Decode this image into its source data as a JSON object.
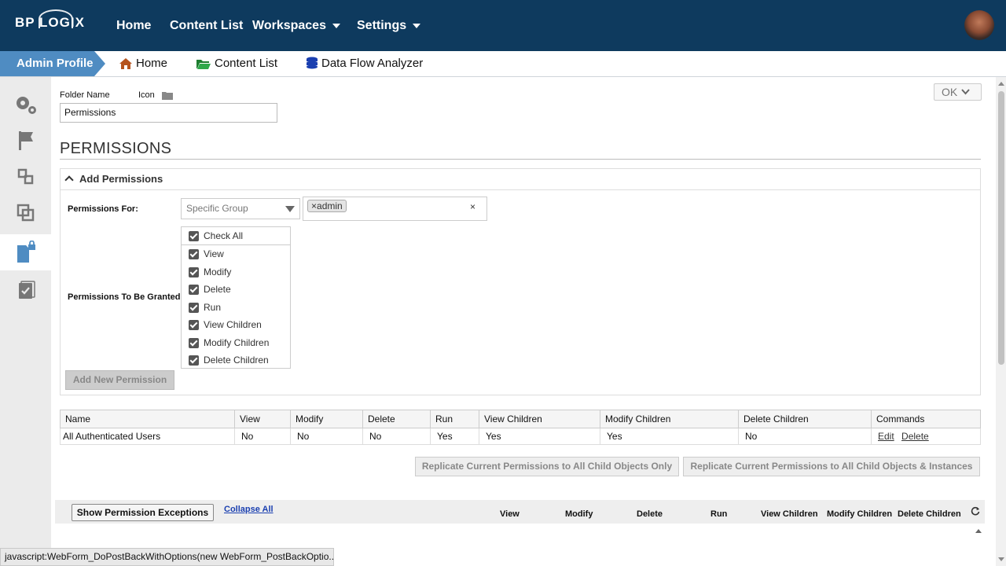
{
  "brand": {
    "logo_text": "BP LOGIX"
  },
  "topnav": {
    "home": "Home",
    "content_list": "Content List",
    "workspaces": "Workspaces",
    "settings": "Settings"
  },
  "subnav": {
    "profile": "Admin Profile",
    "home": "Home",
    "content_list": "Content List",
    "data_flow": "Data Flow Analyzer"
  },
  "sidebar": {
    "items": [
      "gears-icon",
      "flag-icon",
      "nodes-icon",
      "copy-icon",
      "lock-file-icon",
      "checklist-icon"
    ]
  },
  "form": {
    "folder_name_label": "Folder Name",
    "icon_label": "Icon",
    "folder_name_value": "Permissions",
    "ok_label": "OK"
  },
  "section": {
    "title": "PERMISSIONS"
  },
  "add_panel": {
    "title": "Add Permissions",
    "permissions_for_label": "Permissions For:",
    "permissions_for_value": "Specific Group",
    "selected_tag": "admin",
    "tag_remove": "×",
    "tag_clear": "×",
    "granted_label": "Permissions To Be Granted",
    "check_all": "Check All",
    "checks": [
      "View",
      "Modify",
      "Delete",
      "Run",
      "View Children",
      "Modify Children",
      "Delete Children"
    ],
    "add_button": "Add New Permission"
  },
  "table": {
    "headers": [
      "Name",
      "View",
      "Modify",
      "Delete",
      "Run",
      "View Children",
      "Modify Children",
      "Delete Children",
      "Commands"
    ],
    "rows": [
      {
        "name": "All Authenticated Users",
        "view": "No",
        "modify": "No",
        "delete": "No",
        "run": "Yes",
        "view_children": "Yes",
        "modify_children": "Yes",
        "delete_children": "No",
        "edit": "Edit",
        "delete_link": "Delete"
      }
    ]
  },
  "replicate": {
    "child_objects_only": "Replicate Current Permissions to All Child Objects Only",
    "child_objects_instances": "Replicate Current Permissions to All Child Objects & Instances"
  },
  "exceptions": {
    "show_button": "Show Permission Exceptions",
    "collapse_all": "Collapse All",
    "columns": [
      "View",
      "Modify",
      "Delete",
      "Run",
      "View Children",
      "Modify Children",
      "Delete Children"
    ]
  },
  "status_bar": "javascript:WebForm_DoPostBackWithOptions(new WebForm_PostBackOptio..."
}
